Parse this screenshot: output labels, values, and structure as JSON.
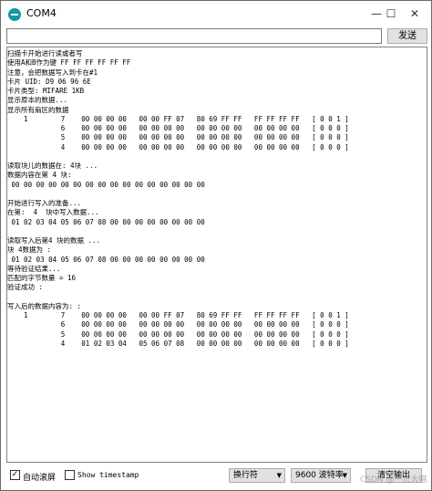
{
  "window": {
    "title": "COM4"
  },
  "window_controls": {
    "minimize": "—",
    "maximize": "☐",
    "close": "✕"
  },
  "toolbar": {
    "send_label": "发送",
    "send_placeholder": ""
  },
  "serial_output_lines": [
    "扫描卡开始进行读或者写",
    "使用A和B作为键 FF FF FF FF FF FF",
    "注意，会把数据写入到卡在#1",
    "卡片 UID: D9 06 96 6E",
    "卡片类型: MIFARE 1KB",
    "显示原本的数据...",
    "显示所有扇区的数据",
    "    1        7    00 00 00 00   00 00 FF 07   80 69 FF FF   FF FF FF FF   [ 0 0 1 ]",
    "             6    00 00 00 00   00 00 00 00   00 00 00 00   00 00 00 00   [ 0 0 0 ]",
    "             5    00 00 00 00   00 00 00 00   00 00 00 00   00 00 00 00   [ 0 0 0 ]",
    "             4    00 00 00 00   00 00 00 00   00 00 00 00   00 00 00 00   [ 0 0 0 ]",
    "",
    "读取块儿的数据在: 4块 ...",
    "数据内容在第 4 块:",
    " 00 00 00 00 00 00 00 00 00 00 00 00 00 00 00 00",
    "",
    "开始进行写入的准备...",
    "在第:  4  块中写入数据...",
    " 01 02 03 04 05 06 07 08 00 00 00 00 00 00 00 00",
    "",
    "读取写入后第4 块的数据 ...",
    "块 4数据为 :",
    " 01 02 03 04 05 06 07 08 00 00 00 00 00 00 00 00",
    "等待验证结果...",
    "匹配的字节数量 = 16",
    "验证成功 :",
    "",
    "写入后的数据内容为: :",
    "    1        7    00 00 00 00   00 00 FF 07   80 69 FF FF   FF FF FF FF   [ 0 0 1 ]",
    "             6    00 00 00 00   00 00 00 00   00 00 00 00   00 00 00 00   [ 0 0 0 ]",
    "             5    00 00 00 00   00 00 00 00   00 00 00 00   00 00 00 00   [ 0 0 0 ]",
    "             4    01 02 03 04   05 06 07 08   00 00 00 00   00 00 00 00   [ 0 0 0 ]"
  ],
  "footer": {
    "autoscroll_label": "自动滚屏",
    "autoscroll_checked": true,
    "timestamp_label": "Show timestamp",
    "timestamp_checked": false,
    "line_ending": "换行符",
    "baud_rate": "9600 波特率",
    "clear_label": "清空输出"
  },
  "watermark": "CSDN @一只大喵",
  "icons": {
    "app": "arduino-icon",
    "dropdown": "chevron-down-icon",
    "check": "checkmark-icon"
  }
}
